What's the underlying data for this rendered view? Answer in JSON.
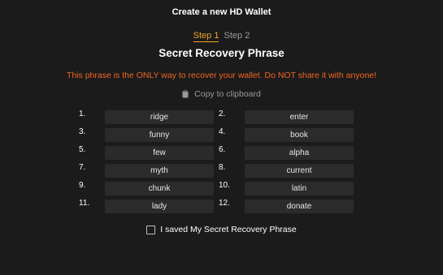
{
  "window": {
    "title": "Create a new HD Wallet"
  },
  "steps": {
    "active": "Step 1",
    "inactive": "Step 2"
  },
  "heading": "Secret Recovery Phrase",
  "warning": "This phrase is the ONLY way to recover your wallet. Do NOT share it with anyone!",
  "copy": {
    "label": "Copy to clipboard",
    "icon": "clipboard-icon"
  },
  "phrase": [
    {
      "num": "1.",
      "word": "ridge"
    },
    {
      "num": "2.",
      "word": "enter"
    },
    {
      "num": "3.",
      "word": "funny"
    },
    {
      "num": "4.",
      "word": "book"
    },
    {
      "num": "5.",
      "word": "few"
    },
    {
      "num": "6.",
      "word": "alpha"
    },
    {
      "num": "7.",
      "word": "myth"
    },
    {
      "num": "8.",
      "word": "current"
    },
    {
      "num": "9.",
      "word": "chunk"
    },
    {
      "num": "10.",
      "word": "latin"
    },
    {
      "num": "11.",
      "word": "lady"
    },
    {
      "num": "12.",
      "word": "donate"
    }
  ],
  "confirm": {
    "label": "I saved My Secret Recovery Phrase",
    "checked": false
  },
  "colors": {
    "accent": "#f5a623",
    "warning": "#f26522",
    "background": "#1b1b1b",
    "cell": "#2b2b2b"
  }
}
